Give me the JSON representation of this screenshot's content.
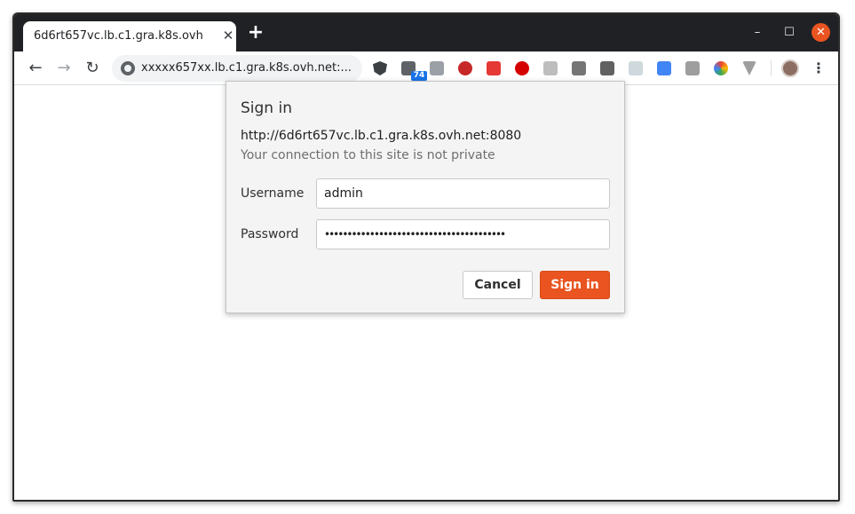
{
  "browser": {
    "tab": {
      "title": "6d6rt657vc.lb.c1.gra.k8s.ovh",
      "close_glyph": "✕"
    },
    "new_tab_glyph": "+",
    "window_controls": {
      "minimize": "–",
      "maximize": "☐",
      "close": "✕"
    },
    "toolbar": {
      "back_glyph": "←",
      "forward_glyph": "→",
      "reload_glyph": "↻",
      "address": "xxxxx657xx.lb.c1.gra.k8s.ovh.net:...",
      "extension_badge": "74",
      "menu_glyph": "⋮"
    },
    "extension_icons": [
      "shield-icon",
      "calendar-icon",
      "tab-icon",
      "mask-icon",
      "red-a-icon",
      "stop-icon",
      "grid-icon",
      "camera-icon",
      "translate-icon",
      "ac-icon",
      "note-icon",
      "puzzle-icon",
      "color-wheel-icon",
      "v-icon"
    ]
  },
  "dialog": {
    "title": "Sign in",
    "url": "http://6d6rt657vc.lb.c1.gra.k8s.ovh.net:8080",
    "note": "Your connection to this site is not private",
    "username_label": "Username",
    "username_value": "admin",
    "password_label": "Password",
    "password_value": "••••••••••••••••••••••••••••••••••••••••",
    "cancel_label": "Cancel",
    "signin_label": "Sign in"
  },
  "colors": {
    "accent": "#e95420",
    "titlebar": "#202124",
    "dialog_bg": "#f4f4f4"
  }
}
